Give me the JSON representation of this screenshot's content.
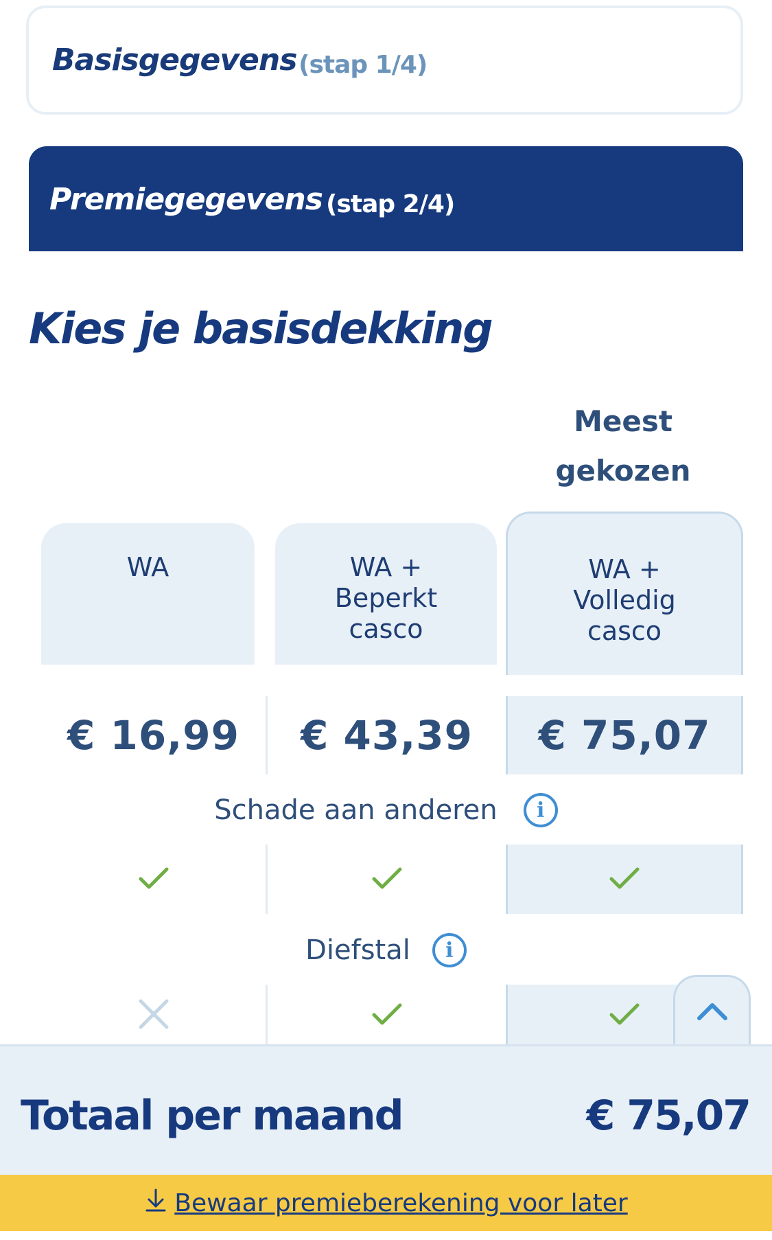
{
  "steps": [
    {
      "title": "Basisgegevens",
      "sub": "(stap 1/4)"
    },
    {
      "title": "Premiegegevens",
      "sub": "(stap 2/4)"
    }
  ],
  "heading": "Kies je basisdekking",
  "popular": {
    "line1": "Meest",
    "line2": "gekozen"
  },
  "plans": [
    {
      "lines": [
        "WA"
      ],
      "price": "€ 16,99"
    },
    {
      "lines": [
        "WA +",
        "Beperkt",
        "casco"
      ],
      "price": "€ 43,39"
    },
    {
      "lines": [
        "WA +",
        "Volledig",
        "casco"
      ],
      "price": "€ 75,07"
    }
  ],
  "coverage": [
    {
      "label": "Schade aan anderen",
      "included": [
        true,
        true,
        true
      ]
    },
    {
      "label": "Diefstal",
      "included": [
        false,
        true,
        true
      ]
    }
  ],
  "icons": {
    "info": "info-icon",
    "check": "check-icon",
    "cross": "cross-icon",
    "scroll_top": "chevron-up-icon",
    "download": "download-icon"
  },
  "info_glyph": "i",
  "footer": {
    "total_label": "Totaal per maand",
    "total_value": "€ 75,07",
    "save_label": "Bewaar premieberekening voor later"
  },
  "colors": {
    "primary": "#173a7f",
    "panel": "#e8f0f7",
    "check": "#6fae44",
    "cross": "#c5d7e6",
    "info": "#3f8ed4",
    "save_bar": "#f6ca45"
  }
}
